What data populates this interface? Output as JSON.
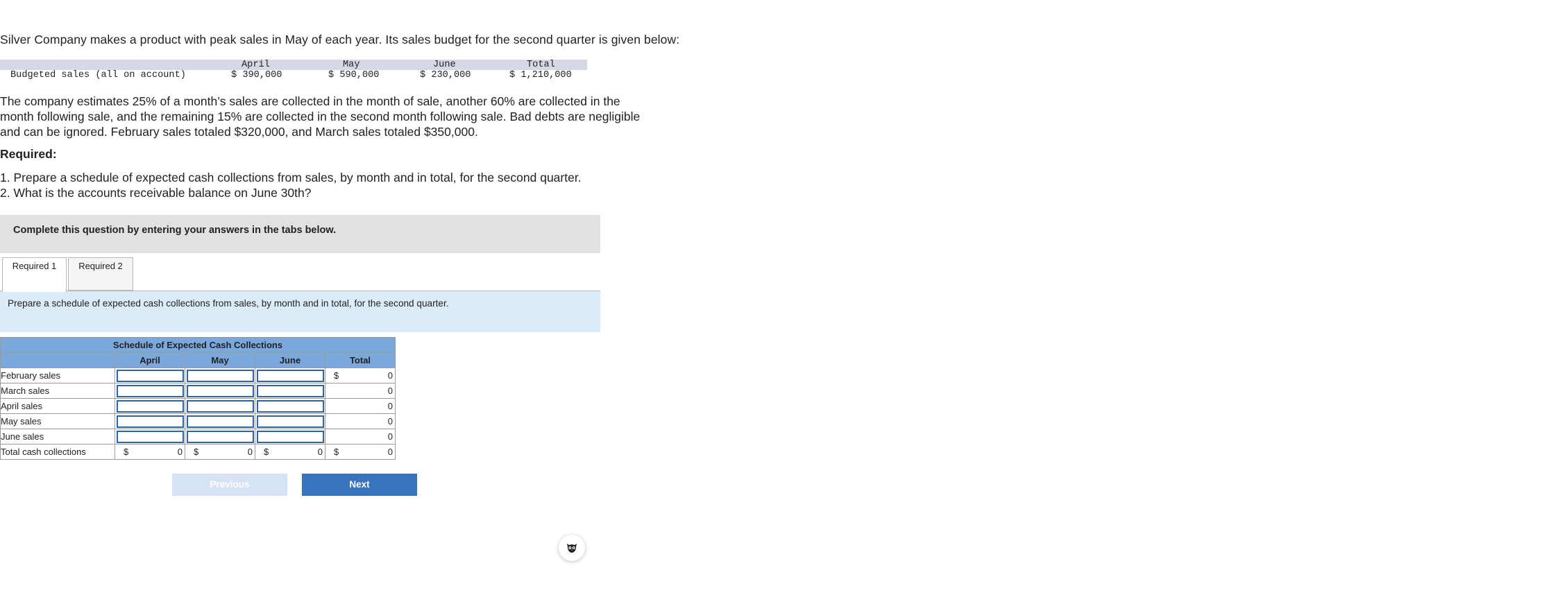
{
  "intro": "Silver Company makes a product with peak sales in May of each year. Its sales budget for the second quarter is given below:",
  "budget": {
    "headers": [
      "April",
      "May",
      "June",
      "Total"
    ],
    "row_label": "Budgeted sales (all on account)",
    "values": [
      "$ 390,000",
      "$ 590,000",
      "$ 230,000",
      "$ 1,210,000"
    ]
  },
  "paragraph": "The company estimates 25% of a month’s sales are collected in the month of sale, another 60% are collected in the month following sale, and the remaining 15% are collected in the second month following sale. Bad debts are negligible and can be ignored. February sales totaled $320,000, and March sales totaled $350,000.",
  "required_title": "Required:",
  "requirements": [
    "1. Prepare a schedule of expected cash collections from sales, by month and in total, for the second quarter.",
    "2. What is the accounts receivable balance on June 30th?"
  ],
  "instruction": "Complete this question by entering your answers in the tabs below.",
  "tabs": [
    "Required 1",
    "Required 2"
  ],
  "prompt": "Prepare a schedule of expected cash collections from sales, by month and in total, for the second quarter.",
  "schedule": {
    "title": "Schedule of Expected Cash Collections",
    "columns": [
      "April",
      "May",
      "June",
      "Total"
    ],
    "rows": [
      {
        "label": "February sales",
        "total": "0",
        "dollar": "$"
      },
      {
        "label": "March sales",
        "total": "0",
        "dollar": ""
      },
      {
        "label": "April sales",
        "total": "0",
        "dollar": ""
      },
      {
        "label": "May sales",
        "total": "0",
        "dollar": ""
      },
      {
        "label": "June sales",
        "total": "0",
        "dollar": ""
      }
    ],
    "total_row": {
      "label": "Total cash collections",
      "dollar": "$",
      "values": [
        "0",
        "0",
        "0",
        "0"
      ]
    }
  },
  "buttons": {
    "previous": "Previous",
    "next": "Next"
  },
  "colors": {
    "header_blue": "#7aa7dc",
    "next_button": "#3a73bd",
    "prompt_bg": "#dcebf8"
  },
  "assistant_icon": "owl-icon"
}
